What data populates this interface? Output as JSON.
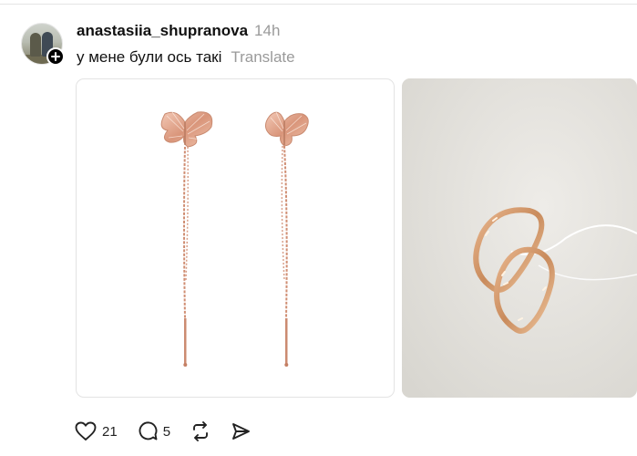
{
  "post": {
    "author": "anastasiia_shupranova",
    "time": "14h",
    "caption": "у мене були ось такі",
    "translate_label": "Translate"
  },
  "media": [
    {
      "kind": "product-photo",
      "subject": "butterfly-threader-earrings"
    },
    {
      "kind": "product-photo",
      "subject": "gold-hoop-earrings"
    }
  ],
  "actions": {
    "like_count": "21",
    "reply_count": "5"
  },
  "icons": {
    "like": "heart-icon",
    "reply": "comment-icon",
    "repost": "repost-icon",
    "share": "send-icon",
    "follow": "plus-icon"
  },
  "colors": {
    "metal": "#d49a7f",
    "background": "#ffffff",
    "muted_text": "#9a9a9a"
  }
}
